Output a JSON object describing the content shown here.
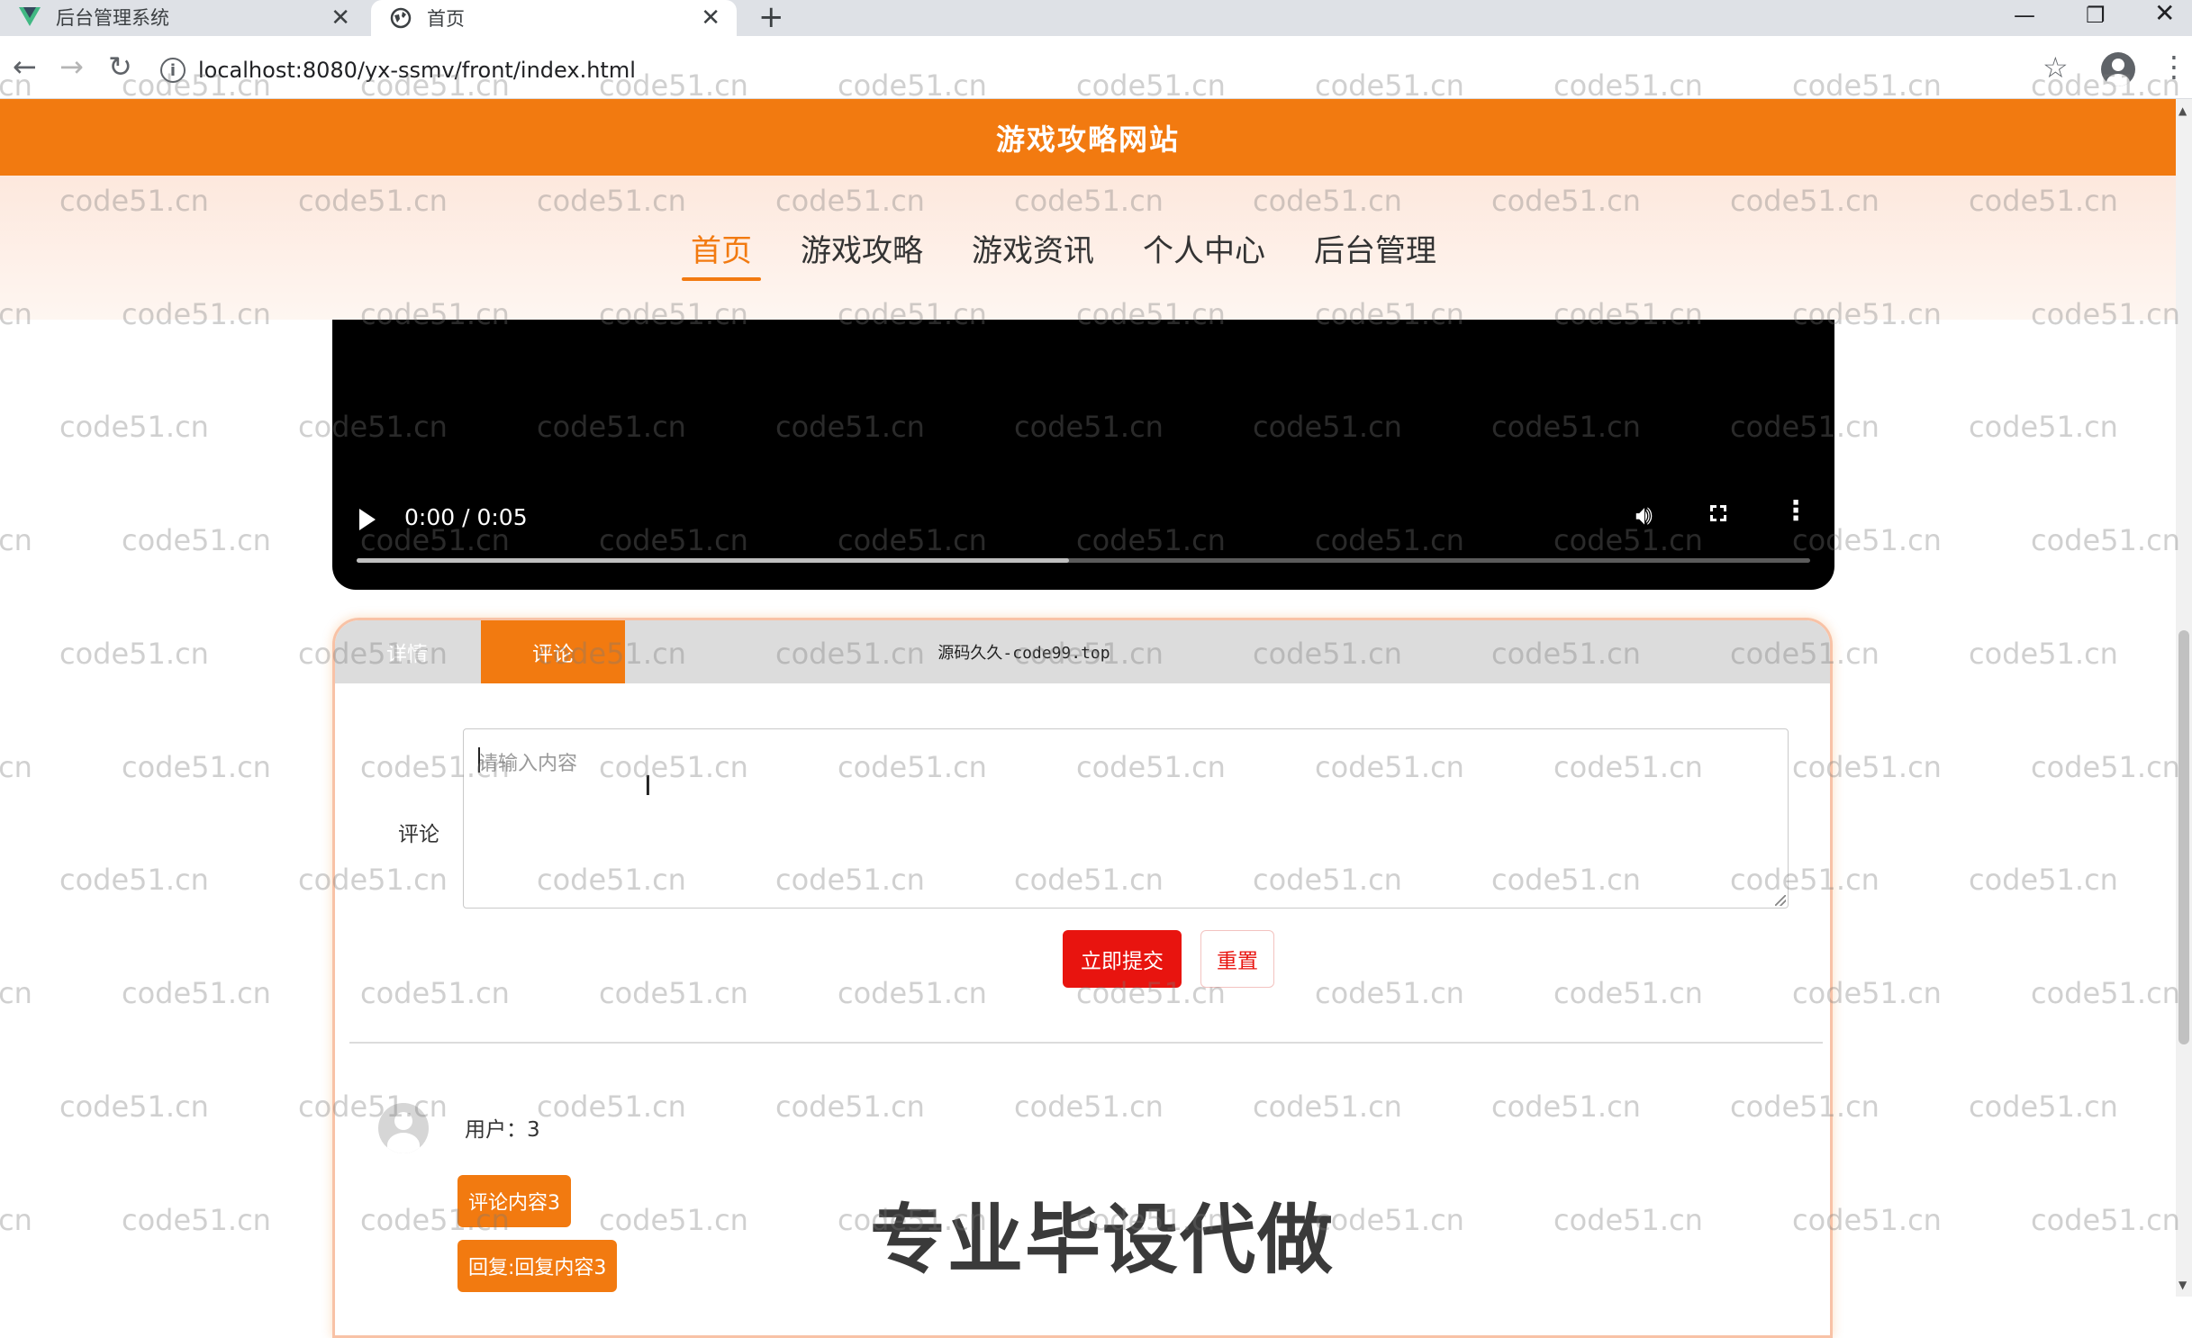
{
  "browser": {
    "tabs": [
      {
        "title": "后台管理系统",
        "active": false
      },
      {
        "title": "首页",
        "active": true
      }
    ],
    "url": "localhost:8080/yx-ssmv/front/index.html"
  },
  "site": {
    "title": "游戏攻略网站",
    "nav": [
      "首页",
      "游戏攻略",
      "游戏资讯",
      "个人中心",
      "后台管理"
    ],
    "active_nav": "首页"
  },
  "video": {
    "time": "0:00 / 0:05",
    "progress": 0.49
  },
  "detail_tabs": {
    "detail": "详情",
    "comment": "评论",
    "banner": "源码久久-code99.top"
  },
  "comment_form": {
    "label": "评论",
    "placeholder": "请输入内容",
    "submit": "立即提交",
    "reset": "重置"
  },
  "comments": [
    {
      "user": "用户：3",
      "content": "评论内容3",
      "reply": "回复:回复内容3"
    }
  ],
  "overlay_caption": "专业毕设代做",
  "watermark": "code51.cn",
  "colors": {
    "accent": "#f27a10",
    "danger": "#e8140f"
  }
}
